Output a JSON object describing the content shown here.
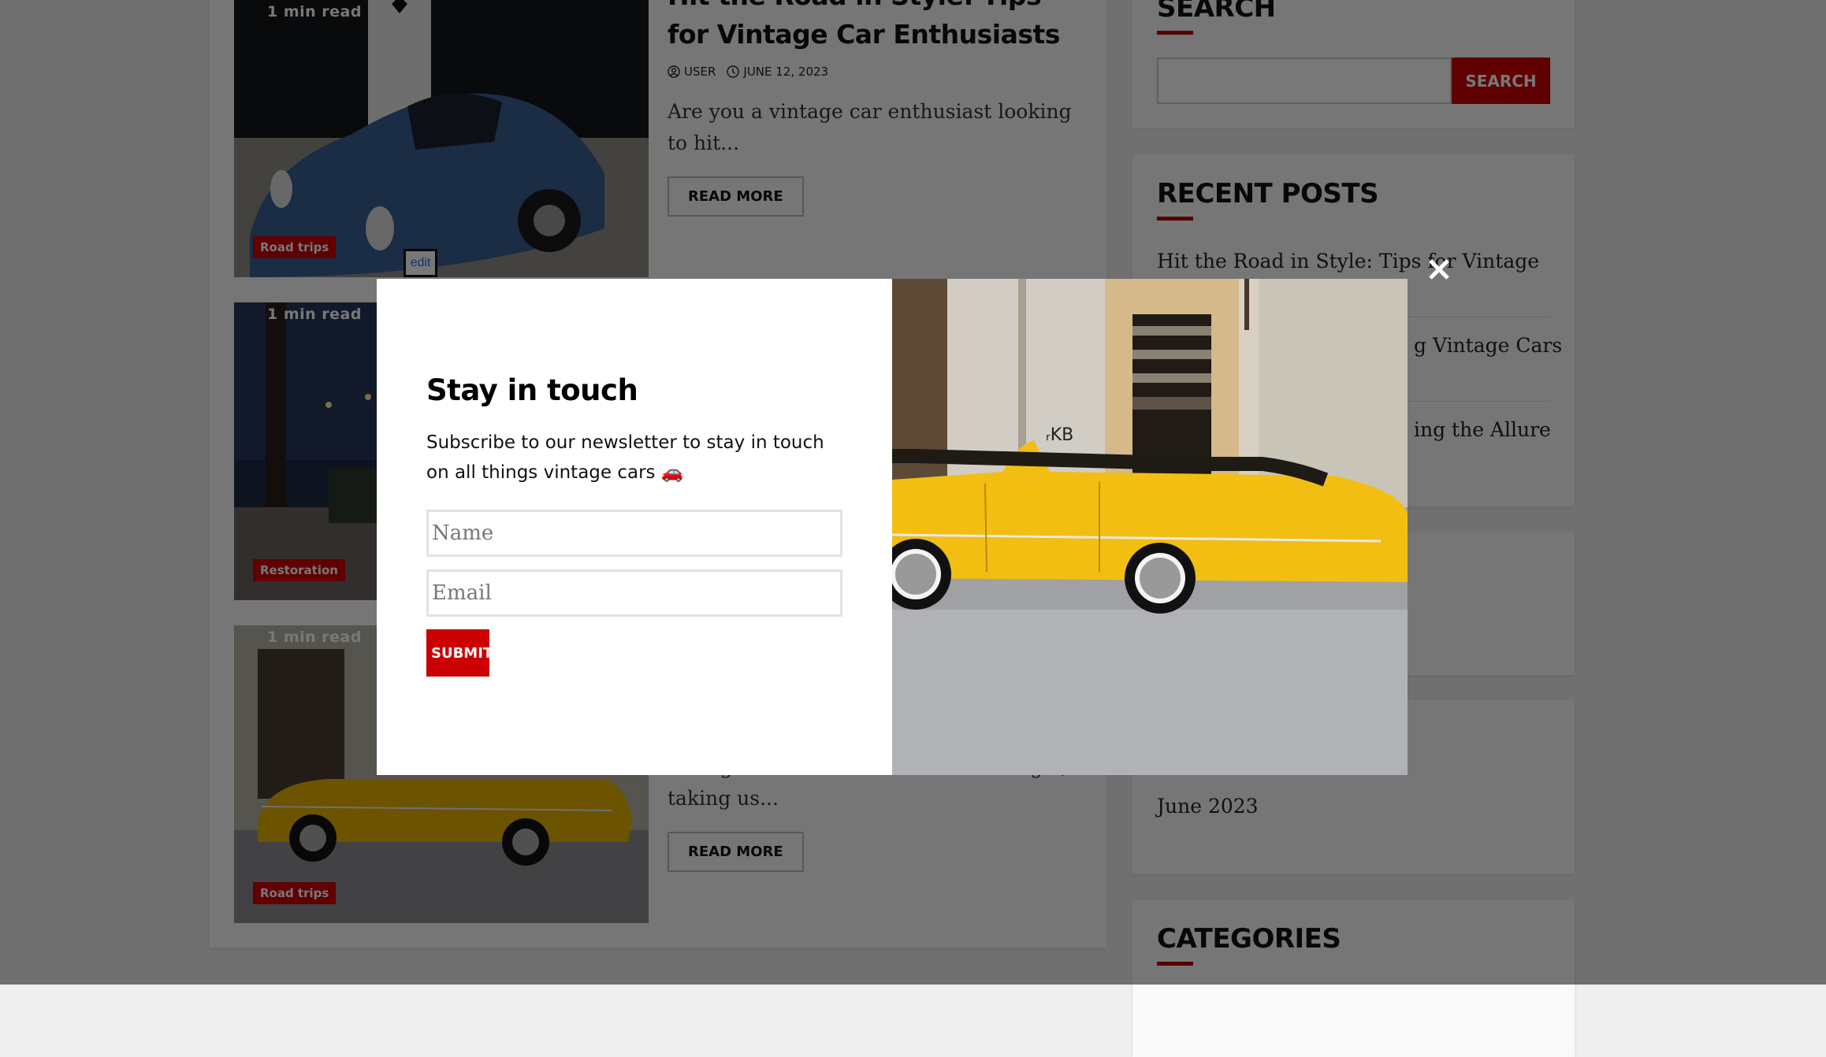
{
  "articles": [
    {
      "read_time": "1 min read",
      "category": "Road trips",
      "title": "Hit the Road in Style: Tips for Vintage Car Enthusiasts",
      "author": "USER",
      "date": "JUNE 12, 2023",
      "excerpt": "Are you a vintage car enthusiast looking to hit...",
      "read_more": "READ MORE",
      "image": "blue-vintage-coupe-photo"
    },
    {
      "read_time": "1 min read",
      "category": "Restoration",
      "image": "night-street-cars-photo"
    },
    {
      "read_time": "1 min read",
      "category": "Road trips",
      "excerpt": "Vintage cars evoke a sense of nostalgia, taking us...",
      "read_more": "READ MORE",
      "image": "yellow-convertible-photo"
    }
  ],
  "edit_link": "edit",
  "sidebar": {
    "search": {
      "title": "SEARCH",
      "input_value": "",
      "button_label": "SEARCH"
    },
    "recent_posts": {
      "title": "RECENT POSTS",
      "items": [
        "Hit the Road in Style: Tips for Vintage Car",
        "g Vintage Cars",
        "ing the Allure"
      ]
    },
    "archives": {
      "items": [
        "June 2023"
      ]
    },
    "categories": {
      "title": "CATEGORIES"
    }
  },
  "modal": {
    "title": "Stay in touch",
    "text": "Subscribe to our newsletter to stay in touch on all things vintage cars 🚗",
    "name_placeholder": "Name",
    "email_placeholder": "Email",
    "submit_label": "SUBMIT",
    "image": "yellow-convertible-photo",
    "close_icon": "close-icon"
  },
  "colors": {
    "accent": "#cc0000",
    "overlay": "rgba(0,0,0,0.53)"
  }
}
